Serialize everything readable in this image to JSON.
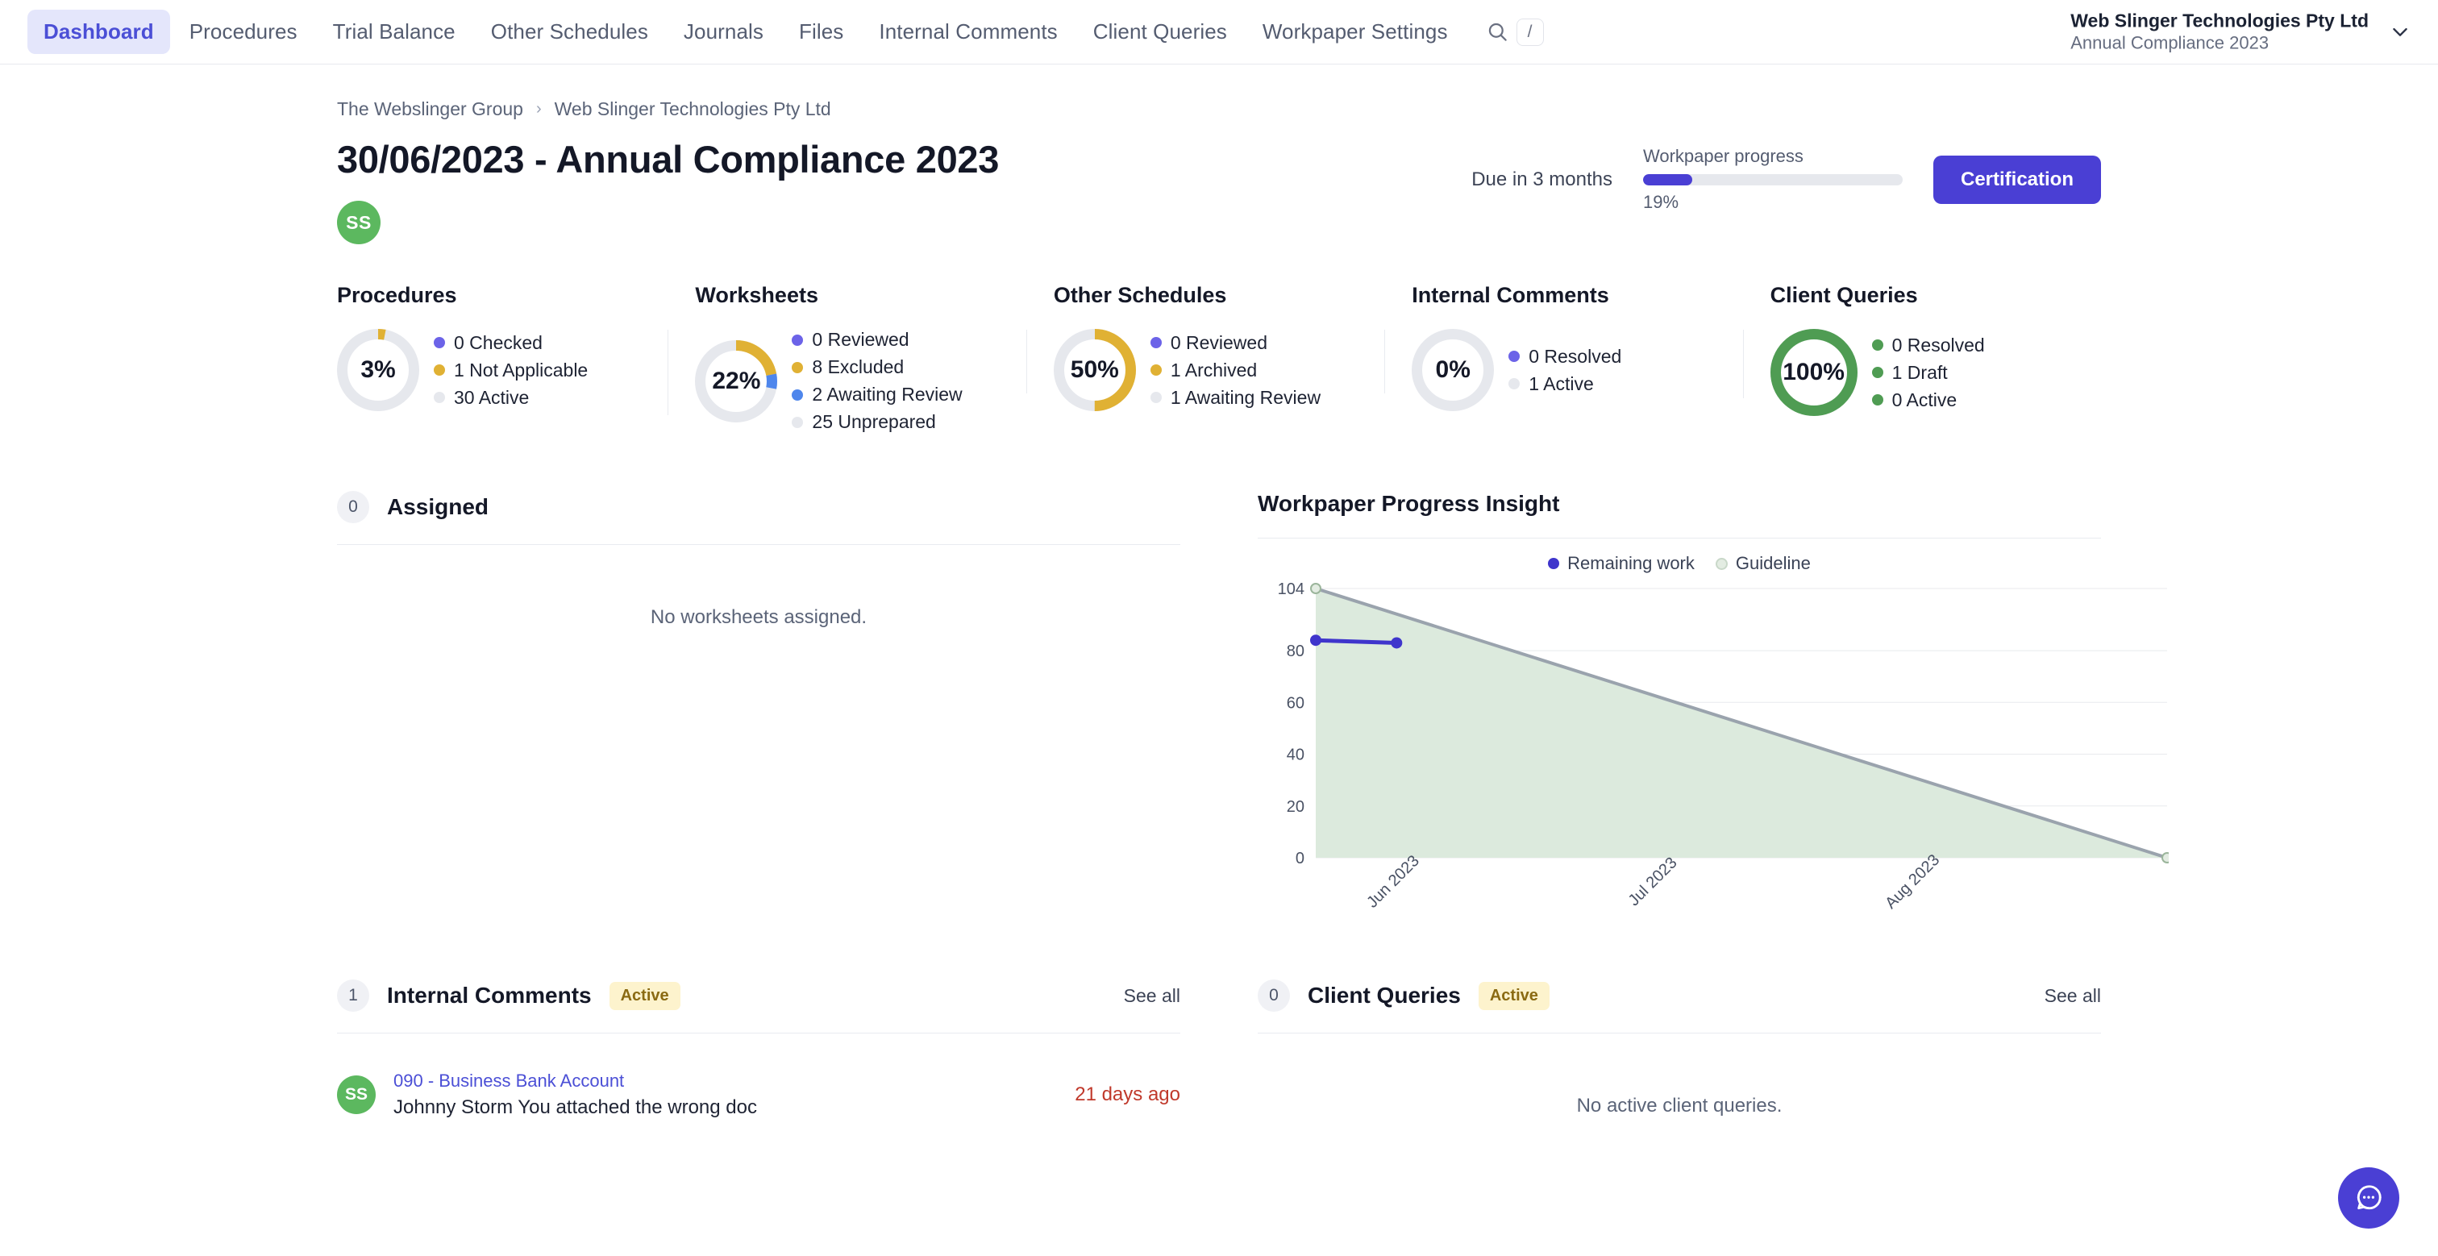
{
  "nav": {
    "items": [
      {
        "label": "Dashboard",
        "active": true
      },
      {
        "label": "Procedures",
        "active": false
      },
      {
        "label": "Trial Balance",
        "active": false
      },
      {
        "label": "Other Schedules",
        "active": false
      },
      {
        "label": "Journals",
        "active": false
      },
      {
        "label": "Files",
        "active": false
      },
      {
        "label": "Internal Comments",
        "active": false
      },
      {
        "label": "Client Queries",
        "active": false
      },
      {
        "label": "Workpaper Settings",
        "active": false
      }
    ],
    "search_shortcut": "/"
  },
  "org": {
    "name": "Web Slinger Technologies Pty Ltd",
    "sub": "Annual Compliance 2023"
  },
  "breadcrumb": {
    "parent": "The Webslinger Group",
    "separator": "›",
    "current": "Web Slinger Technologies Pty Ltd"
  },
  "header": {
    "title": "30/06/2023 - Annual Compliance 2023",
    "due": "Due in 3 months",
    "progress_label": "Workpaper progress",
    "progress_pct_text": "19%",
    "progress_pct_value": 19,
    "certification_label": "Certification",
    "avatar_initials": "SS"
  },
  "colors": {
    "accent": "#4a3fd4",
    "purple_dot": "#6c63e8",
    "yellow": "#e0b134",
    "blue": "#4e86ec",
    "grey": "#e6e8ed",
    "green": "#4f9c53",
    "area_fill": "#dceadd",
    "guideline": "#9aa3ad",
    "danger": "#c0392b"
  },
  "stats": [
    {
      "title": "Procedures",
      "pct": "3%",
      "pct_value": 3,
      "segments": [
        {
          "label": "Checked",
          "value": 0,
          "color": "#6c63e8",
          "pct": 0
        },
        {
          "label": "Not Applicable",
          "value": 1,
          "color": "#e0b134",
          "pct": 3
        },
        {
          "label": "Active",
          "value": 30,
          "color": "#e6e8ed",
          "pct": 97
        }
      ],
      "legend": [
        {
          "count": "0",
          "label": "Checked",
          "color": "#6c63e8"
        },
        {
          "count": "1",
          "label": "Not Applicable",
          "color": "#e0b134"
        },
        {
          "count": "30",
          "label": "Active",
          "color": "#e6e8ed"
        }
      ]
    },
    {
      "title": "Worksheets",
      "pct": "22%",
      "pct_value": 22,
      "segments": [
        {
          "label": "Reviewed",
          "value": 0,
          "color": "#6c63e8",
          "pct": 0
        },
        {
          "label": "Excluded",
          "value": 8,
          "color": "#e0b134",
          "pct": 22
        },
        {
          "label": "Awaiting Review",
          "value": 2,
          "color": "#4e86ec",
          "pct": 6
        },
        {
          "label": "Unprepared",
          "value": 25,
          "color": "#e6e8ed",
          "pct": 72
        }
      ],
      "legend": [
        {
          "count": "0",
          "label": "Reviewed",
          "color": "#6c63e8"
        },
        {
          "count": "8",
          "label": "Excluded",
          "color": "#e0b134"
        },
        {
          "count": "2",
          "label": "Awaiting Review",
          "color": "#4e86ec"
        },
        {
          "count": "25",
          "label": "Unprepared",
          "color": "#e6e8ed"
        }
      ]
    },
    {
      "title": "Other Schedules",
      "pct": "50%",
      "pct_value": 50,
      "segments": [
        {
          "label": "Reviewed",
          "value": 0,
          "color": "#6c63e8",
          "pct": 0
        },
        {
          "label": "Archived",
          "value": 1,
          "color": "#e0b134",
          "pct": 50
        },
        {
          "label": "Awaiting Review",
          "value": 1,
          "color": "#e6e8ed",
          "pct": 50
        }
      ],
      "legend": [
        {
          "count": "0",
          "label": "Reviewed",
          "color": "#6c63e8"
        },
        {
          "count": "1",
          "label": "Archived",
          "color": "#e0b134"
        },
        {
          "count": "1",
          "label": "Awaiting Review",
          "color": "#e6e8ed"
        }
      ]
    },
    {
      "title": "Internal Comments",
      "pct": "0%",
      "pct_value": 0,
      "segments": [
        {
          "label": "Resolved",
          "value": 0,
          "color": "#6c63e8",
          "pct": 0
        },
        {
          "label": "Active",
          "value": 1,
          "color": "#e6e8ed",
          "pct": 100
        }
      ],
      "legend": [
        {
          "count": "0",
          "label": "Resolved",
          "color": "#6c63e8"
        },
        {
          "count": "1",
          "label": "Active",
          "color": "#e6e8ed"
        }
      ]
    },
    {
      "title": "Client Queries",
      "pct": "100%",
      "pct_value": 100,
      "segments": [
        {
          "label": "Resolved",
          "value": 0,
          "color": "#4f9c53",
          "pct": 100
        }
      ],
      "legend": [
        {
          "count": "0",
          "label": "Resolved",
          "color": "#4f9c53"
        },
        {
          "count": "1",
          "label": "Draft",
          "color": "#4f9c53"
        },
        {
          "count": "0",
          "label": "Active",
          "color": "#4f9c53"
        }
      ]
    }
  ],
  "assigned": {
    "count": "0",
    "title": "Assigned",
    "empty": "No worksheets assigned."
  },
  "insight": {
    "title": "Workpaper Progress Insight"
  },
  "chart_data": {
    "type": "line",
    "title": "Workpaper Progress Insight",
    "xlabel": "",
    "ylabel": "",
    "ylim": [
      0,
      104
    ],
    "yticks": [
      0,
      20,
      40,
      60,
      80,
      104
    ],
    "ytick_labels": [
      "0",
      "20",
      "40",
      "60",
      "80",
      "104"
    ],
    "grid": true,
    "legend_position": "top-center",
    "x_tick_labels": [
      "Jun 2023",
      "Jul 2023",
      "Aug 2023"
    ],
    "x_tick_rotation": -45,
    "series": [
      {
        "name": "Remaining work",
        "color": "#3f35cc",
        "type": "line",
        "marker": "circle",
        "x": [
          0.0,
          0.095
        ],
        "y": [
          84,
          83
        ]
      },
      {
        "name": "Guideline",
        "color": "#9aa3ad",
        "type": "area",
        "fill": "#dceadd",
        "marker": "open-circle",
        "x": [
          0.0,
          1.0
        ],
        "y": [
          104,
          0
        ]
      }
    ]
  },
  "internal_comments": {
    "count": "1",
    "title": "Internal Comments",
    "badge": "Active",
    "see_all": "See all",
    "items": [
      {
        "initials": "SS",
        "link": "090 - Business Bank Account",
        "text": "Johnny Storm You attached the wrong doc",
        "time": "21 days ago"
      }
    ]
  },
  "client_queries": {
    "count": "0",
    "title": "Client Queries",
    "badge": "Active",
    "see_all": "See all",
    "empty": "No active client queries."
  },
  "fab": {
    "icon": "chat-bubble-icon"
  }
}
